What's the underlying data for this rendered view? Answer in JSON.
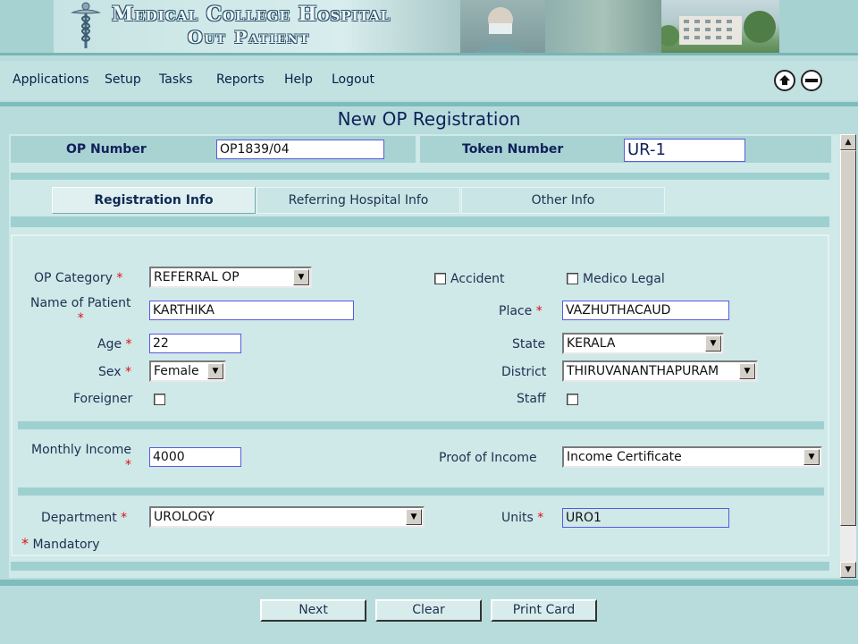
{
  "banner": {
    "title": "Medical College Hospital",
    "subtitle": "Out Patient"
  },
  "menu": {
    "items": [
      "Applications",
      "Setup",
      "Tasks",
      "Reports",
      "Help",
      "Logout"
    ],
    "home_icon": "home-icon",
    "minimize_icon": "minimize-icon"
  },
  "page": {
    "title": "New OP Registration"
  },
  "header_fields": {
    "op_number_label": "OP Number",
    "op_number_value": "OP1839/04",
    "token_number_label": "Token Number",
    "token_number_value": "UR-1"
  },
  "tabs": [
    {
      "label": "Registration Info",
      "active": true
    },
    {
      "label": "Referring Hospital Info",
      "active": false
    },
    {
      "label": "Other Info",
      "active": false
    }
  ],
  "form": {
    "op_category": {
      "label": "OP Category",
      "value": "REFERRAL OP"
    },
    "accident": {
      "label": "Accident",
      "checked": false
    },
    "medico_legal": {
      "label": "Medico Legal",
      "checked": false
    },
    "name_of_patient": {
      "label": "Name of Patient",
      "value": "KARTHIKA"
    },
    "place": {
      "label": "Place",
      "value": "VAZHUTHACAUD"
    },
    "age": {
      "label": "Age",
      "value": "22"
    },
    "state": {
      "label": "State",
      "value": "KERALA"
    },
    "sex": {
      "label": "Sex",
      "value": "Female"
    },
    "district": {
      "label": "District",
      "value": "THIRUVANANTHAPURAM"
    },
    "foreigner": {
      "label": "Foreigner",
      "checked": false
    },
    "staff": {
      "label": "Staff",
      "checked": false
    },
    "monthly_income": {
      "label": "Monthly Income",
      "value": "4000"
    },
    "proof_of_income": {
      "label": "Proof of Income",
      "value": "Income Certificate"
    },
    "department": {
      "label": "Department",
      "value": "UROLOGY"
    },
    "units": {
      "label": "Units",
      "value": "URO1"
    },
    "required_marker": "*",
    "mandatory_note": "Mandatory"
  },
  "buttons": {
    "next": "Next",
    "clear": "Clear",
    "print_card": "Print Card"
  },
  "colors": {
    "background": "#b8dcdc",
    "band": "#9fd0d0",
    "title": "#10205a",
    "required": "#e01010"
  }
}
